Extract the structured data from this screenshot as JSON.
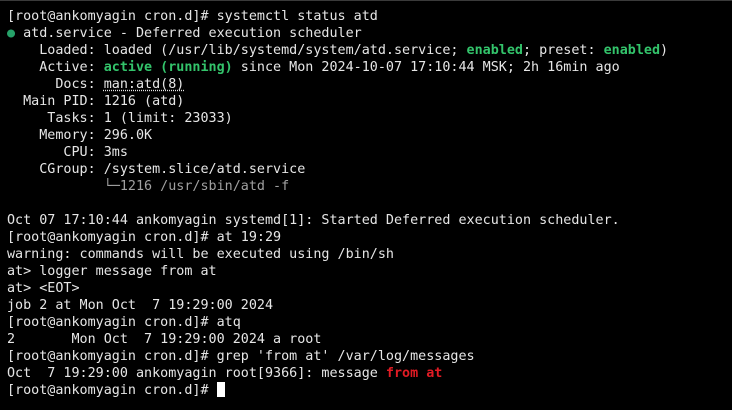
{
  "terminal": {
    "prompt": "[root@ankomyagin cron.d]#",
    "cmd1": " systemctl status atd",
    "service_dot": "●",
    "service_title": " atd.service - Deferred execution scheduler",
    "loaded": {
      "label": "    Loaded: ",
      "pre": "loaded (/usr/lib/systemd/system/atd.service; ",
      "enabled1": "enabled",
      "mid": "; preset: ",
      "enabled2": "enabled",
      "post": ")"
    },
    "active": {
      "label": "    Active: ",
      "state": "active (running)",
      "rest": " since Mon 2024-10-07 17:10:44 MSK; 2h 16min ago"
    },
    "docs": {
      "label": "      Docs: ",
      "value": "man:atd(8)"
    },
    "main_pid": "  Main PID: 1216 (atd)",
    "tasks": "     Tasks: 1 (limit: 23033)",
    "memory": "    Memory: 296.0K",
    "cpu": "       CPU: 3ms",
    "cgroup": "    CGroup: /system.slice/atd.service",
    "cgroup_child": "            └─1216 /usr/sbin/atd -f",
    "log_line": "Oct 07 17:10:44 ankomyagin systemd[1]: Started Deferred execution scheduler.",
    "cmd2": " at 19:29",
    "warning": "warning: commands will be executed using /bin/sh",
    "at_input": "at> logger message from at",
    "at_eot": "at> <EOT>",
    "job_line": "job 2 at Mon Oct  7 19:29:00 2024",
    "cmd3": " atq",
    "atq_line": "2       Mon Oct  7 19:29:00 2024 a root",
    "cmd4": " grep 'from at' /var/log/messages",
    "grep_result": {
      "pre": "Oct  7 19:29:00 ankomyagin root[9366]: message ",
      "match": "from at"
    },
    "final_prompt": "[root@ankomyagin cron.d]# "
  },
  "colors": {
    "background": "#000000",
    "text": "#e6e6e6",
    "green": "#33c46b",
    "red": "#e01b24"
  }
}
